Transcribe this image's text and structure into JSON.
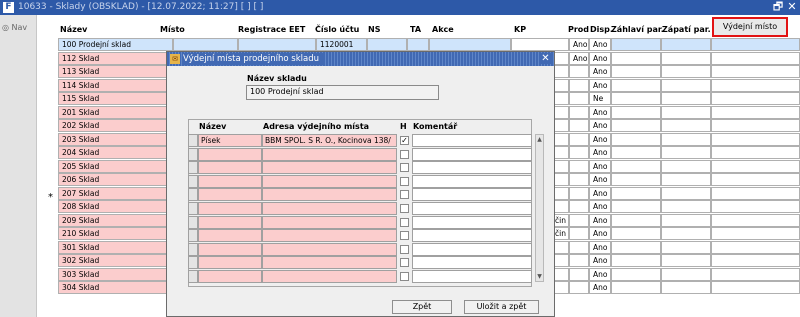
{
  "window": {
    "title": "10633 - Sklady (OBSKLAD) - [12.07.2022; 11:27] [ ] [ ]",
    "restore_symbol": "🗗",
    "close_symbol": "✕"
  },
  "nav": {
    "label": "Nav"
  },
  "columns": {
    "nazev": "Název",
    "misto": "Místo",
    "registrace": "Registrace EET",
    "cislo_uctu": "Číslo účtu",
    "ns": "NS",
    "ta": "TA",
    "akce": "Akce",
    "kp": "KP",
    "prod": "Prod",
    "disp": "Disp.",
    "zahlavi": "Záhlaví par.",
    "zapati": "Zápatí par."
  },
  "vydejni_button": "Výdejní místo",
  "rows": [
    {
      "nazev": "100 Prodejní sklad",
      "cislo": "1120001",
      "prod": "Ano",
      "disp": "Ano",
      "ext": ""
    },
    {
      "nazev": "112 Sklad",
      "cislo": "",
      "prod": "Ano",
      "disp": "Ano",
      "ext": ""
    },
    {
      "nazev": "113 Sklad",
      "cislo": "",
      "prod": "",
      "disp": "Ano",
      "ext": ""
    },
    {
      "nazev": "114 Sklad",
      "cislo": "",
      "prod": "",
      "disp": "Ano",
      "ext": ""
    },
    {
      "nazev": "115 Sklad",
      "cislo": "",
      "prod": "",
      "disp": "Ne",
      "ext": ""
    },
    {
      "nazev": "201 Sklad",
      "cislo": "",
      "prod": "",
      "disp": "Ano",
      "ext": ""
    },
    {
      "nazev": "202 Sklad",
      "cislo": "",
      "prod": "",
      "disp": "Ano",
      "ext": ""
    },
    {
      "nazev": "203 Sklad",
      "cislo": "",
      "prod": "",
      "disp": "Ano",
      "ext": ""
    },
    {
      "nazev": "204 Sklad",
      "cislo": "",
      "prod": "",
      "disp": "Ano",
      "ext": ""
    },
    {
      "nazev": "205 Sklad",
      "cislo": "",
      "prod": "",
      "disp": "Ano",
      "ext": ""
    },
    {
      "nazev": "206 Sklad",
      "cislo": "",
      "prod": "",
      "disp": "Ano",
      "ext": ""
    },
    {
      "nazev": "207 Sklad",
      "cislo": "",
      "prod": "",
      "disp": "Ano",
      "ext": ""
    },
    {
      "nazev": "208 Sklad",
      "cislo": "",
      "prod": "",
      "disp": "Ano",
      "ext": ""
    },
    {
      "nazev": "209 Sklad",
      "cislo": "",
      "prod": "",
      "disp": "Ano",
      "ext": "čin"
    },
    {
      "nazev": "210 Sklad",
      "cislo": "",
      "prod": "",
      "disp": "Ano",
      "ext": "čin"
    },
    {
      "nazev": "301 Sklad",
      "cislo": "",
      "prod": "",
      "disp": "Ano",
      "ext": ""
    },
    {
      "nazev": "302 Sklad",
      "cislo": "",
      "prod": "",
      "disp": "Ano",
      "ext": ""
    },
    {
      "nazev": "303 Sklad",
      "cislo": "",
      "prod": "",
      "disp": "Ano",
      "ext": ""
    },
    {
      "nazev": "304 Sklad",
      "cislo": "",
      "prod": "",
      "disp": "Ano",
      "ext": ""
    }
  ],
  "current_row_marker": "*",
  "dialog": {
    "title": "Výdejní místa prodejního skladu",
    "nazev_skladu_label": "Název skladu",
    "nazev_skladu_value": "100 Prodejní sklad",
    "grid": {
      "col_nazev": "Název",
      "col_adresa": "Adresa výdejního místa",
      "col_h": "H",
      "col_komentar": "Komentář",
      "rows": [
        {
          "nazev": "Písek",
          "adresa": "BBM SPOL. S R. O., Kocinova 138/",
          "h": "✓",
          "komentar": ""
        },
        {
          "nazev": "",
          "adresa": "",
          "h": "",
          "komentar": ""
        },
        {
          "nazev": "",
          "adresa": "",
          "h": "",
          "komentar": ""
        },
        {
          "nazev": "",
          "adresa": "",
          "h": "",
          "komentar": ""
        },
        {
          "nazev": "",
          "adresa": "",
          "h": "",
          "komentar": ""
        },
        {
          "nazev": "",
          "adresa": "",
          "h": "",
          "komentar": ""
        },
        {
          "nazev": "",
          "adresa": "",
          "h": "",
          "komentar": ""
        },
        {
          "nazev": "",
          "adresa": "",
          "h": "",
          "komentar": ""
        },
        {
          "nazev": "",
          "adresa": "",
          "h": "",
          "komentar": ""
        },
        {
          "nazev": "",
          "adresa": "",
          "h": "",
          "komentar": ""
        },
        {
          "nazev": "",
          "adresa": "",
          "h": "",
          "komentar": ""
        }
      ]
    },
    "btn_zpet": "Zpět",
    "btn_ulozit": "Uložit a zpět"
  }
}
